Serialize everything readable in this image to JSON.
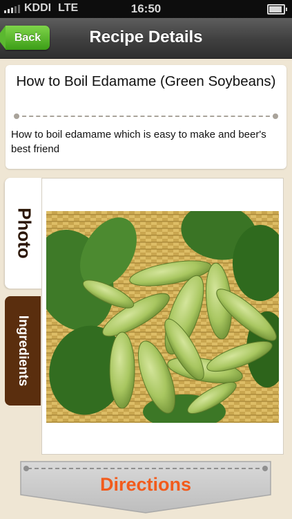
{
  "status": {
    "carrier": "KDDI",
    "network": "LTE",
    "time": "16:50"
  },
  "nav": {
    "back_label": "Back",
    "title": "Recipe Details"
  },
  "recipe": {
    "title": "How to Boil Edamame (Green Soybeans)",
    "description": "How to boil edamame which is easy to make and beer's best friend"
  },
  "tabs": [
    {
      "label": "Photo",
      "selected": true
    },
    {
      "label": "Ingredients",
      "selected": false
    }
  ],
  "photo": {
    "subject": "edamame pods on a wicker basket"
  },
  "directions_button": {
    "label": "Directions"
  },
  "colors": {
    "accent": "#f25b1c",
    "tab_brown": "#5a2e0e",
    "back_green": "#4aad20",
    "background": "#efe6d4"
  }
}
